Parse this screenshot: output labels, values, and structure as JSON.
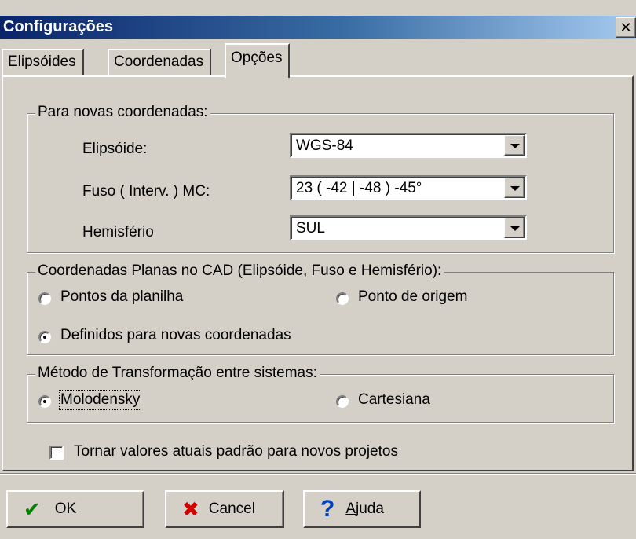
{
  "window": {
    "title": "Configurações",
    "close_symbol": "✕"
  },
  "tabs": [
    "Elipsóides",
    "Coordenadas",
    "Opções"
  ],
  "active_tab": "Opções",
  "group_new_coords": {
    "legend": "Para novas coordenadas:",
    "ellipsoid_label": "Elipsóide:",
    "ellipsoid_value": "WGS-84",
    "fuso_label": "Fuso ( Interv. ) MC:",
    "fuso_value": " 23  ( -42  |  -48  ) -45°",
    "hemisphere_label": "Hemisfério",
    "hemisphere_value": "SUL"
  },
  "group_cad": {
    "legend": "Coordenadas Planas no CAD (Elipsóide, Fuso e Hemisfério):",
    "options": [
      "Pontos da planilha",
      "Ponto de origem",
      "Definidos para novas coordenadas"
    ],
    "selected": "Definidos para novas coordenadas"
  },
  "group_method": {
    "legend": "Método de Transformação entre sistemas:",
    "options": [
      "Molodensky",
      "Cartesiana"
    ],
    "selected": "Molodensky"
  },
  "default_checkbox": {
    "label": "Tornar valores atuais padrão para novos projetos",
    "checked": false
  },
  "buttons": {
    "ok": "OK",
    "cancel": "Cancel",
    "help_mnemonic": "A",
    "help_rest": "juda"
  },
  "icons": {
    "ok": "check-icon",
    "cancel": "x-icon",
    "help": "question-icon"
  },
  "colors": {
    "ok_icon": "#008000",
    "cancel_icon": "#d00000",
    "help_icon": "#0040c0",
    "title_start": "#0a246a",
    "title_end": "#a6caf0"
  }
}
